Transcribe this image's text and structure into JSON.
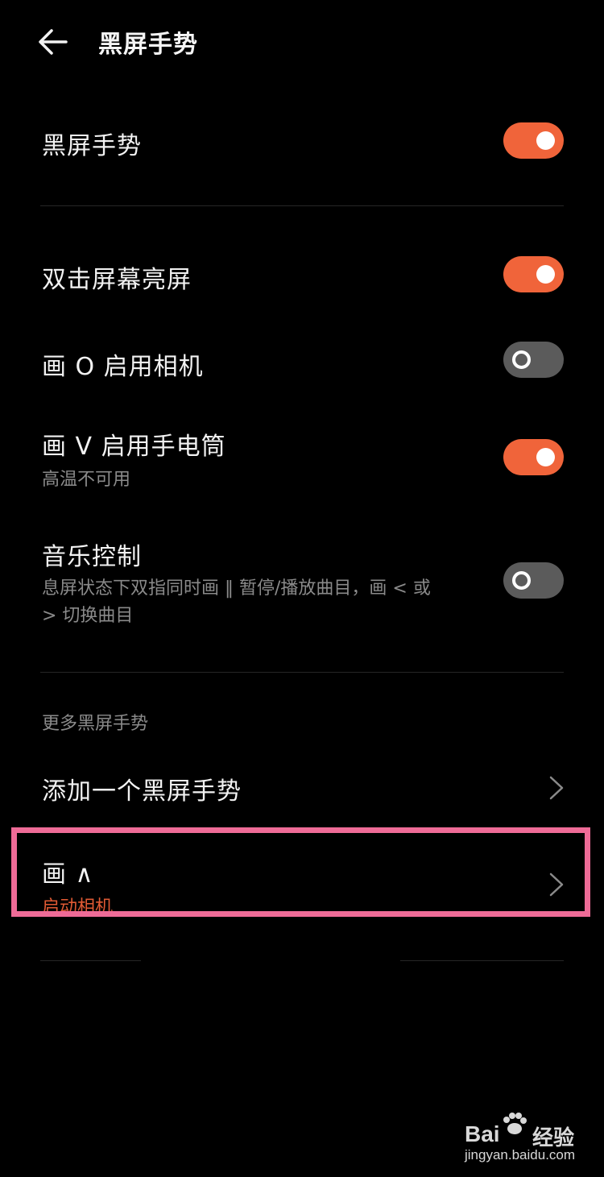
{
  "header": {
    "title": "黑屏手势"
  },
  "main_toggle": {
    "label": "黑屏手势",
    "state": "on"
  },
  "gestures": [
    {
      "label": "双击屏幕亮屏",
      "sub": "",
      "state": "on"
    },
    {
      "label": "画 O 启用相机",
      "sub": "",
      "state": "off"
    },
    {
      "label": "画 V 启用手电筒",
      "sub": "高温不可用",
      "state": "on"
    },
    {
      "label": "音乐控制",
      "sub_line1": "息屏状态下双指同时画 ‖ 暂停/播放曲目，画 < 或",
      "sub_line2": "> 切换曲目",
      "state": "off"
    }
  ],
  "more": {
    "section_label": "更多黑屏手势",
    "add_label": "添加一个黑屏手势",
    "custom_label": "画 ∧",
    "custom_sub": "启动相机"
  },
  "watermark": {
    "brand": "Bai",
    "brand2": "经验",
    "url": "jingyan.baidu.com"
  },
  "colors": {
    "accent": "#f0643a",
    "highlight": "#ee6b97",
    "background": "#000000"
  }
}
